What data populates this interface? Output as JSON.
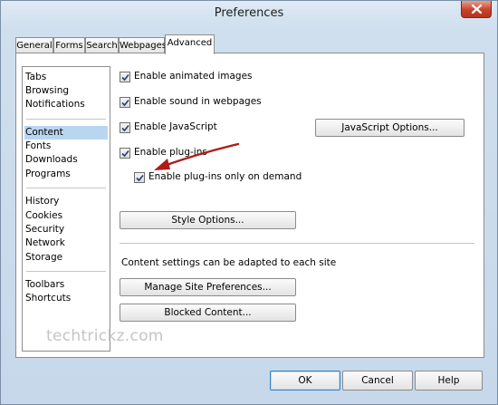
{
  "window": {
    "title": "Preferences"
  },
  "tabs": [
    {
      "label": "General",
      "active": false
    },
    {
      "label": "Forms",
      "active": false
    },
    {
      "label": "Search",
      "active": false
    },
    {
      "label": "Webpages",
      "active": false
    },
    {
      "label": "Advanced",
      "active": true
    }
  ],
  "categories": [
    {
      "label": "Tabs",
      "selected": false
    },
    {
      "label": "Browsing",
      "selected": false
    },
    {
      "label": "Notifications",
      "selected": false
    },
    {
      "label": "Content",
      "selected": true
    },
    {
      "label": "Fonts",
      "selected": false
    },
    {
      "label": "Downloads",
      "selected": false
    },
    {
      "label": "Programs",
      "selected": false
    },
    {
      "label": "History",
      "selected": false
    },
    {
      "label": "Cookies",
      "selected": false
    },
    {
      "label": "Security",
      "selected": false
    },
    {
      "label": "Network",
      "selected": false
    },
    {
      "label": "Storage",
      "selected": false
    },
    {
      "label": "Toolbars",
      "selected": false
    },
    {
      "label": "Shortcuts",
      "selected": false
    }
  ],
  "content": {
    "options": [
      {
        "label": "Enable animated images",
        "checked": true
      },
      {
        "label": "Enable sound in webpages",
        "checked": true
      },
      {
        "label": "Enable JavaScript",
        "checked": true
      },
      {
        "label": "Enable plug-ins",
        "checked": true
      },
      {
        "label": "Enable plug-ins only on demand",
        "checked": true
      }
    ],
    "javascript_options_button": "JavaScript Options...",
    "style_options_button": "Style Options...",
    "site_note": "Content settings can be adapted to each site",
    "manage_site_button": "Manage Site Preferences...",
    "blocked_content_button": "Blocked Content..."
  },
  "footer": {
    "ok": "OK",
    "cancel": "Cancel",
    "help": "Help"
  },
  "watermark": "techtrickz.com",
  "colors": {
    "selection": "#b9d6f1",
    "arrow": "#b01a1a",
    "close_button": "#c7422a"
  }
}
